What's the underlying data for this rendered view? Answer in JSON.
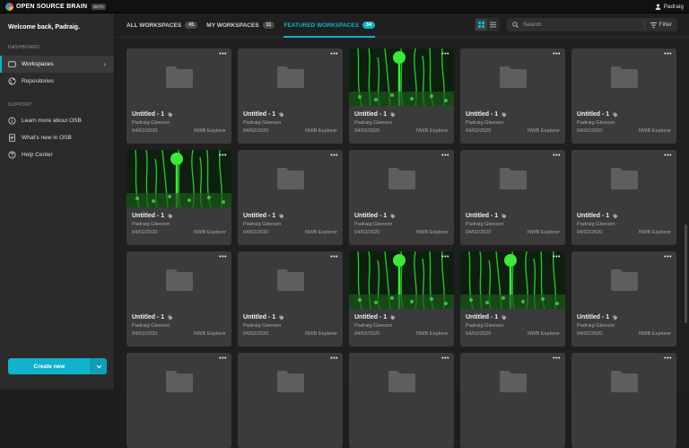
{
  "topbar": {
    "brand": "OPEN SOURCE BRAIN",
    "badge": "BETA",
    "user": "Padraig"
  },
  "sidebar": {
    "welcome": "Welcome back, Padraig.",
    "dashboard_title": "DASHBOARD",
    "items": [
      {
        "label": "Workspaces",
        "icon": "folder-icon",
        "active": true
      },
      {
        "label": "Repositories",
        "icon": "globe-icon"
      }
    ],
    "support_title": "SUPPORT",
    "support_items": [
      {
        "label": "Learn more about OSB",
        "icon": "info-icon"
      },
      {
        "label": "What's new in OSB",
        "icon": "document-icon"
      },
      {
        "label": "Help Center",
        "icon": "help-icon"
      }
    ],
    "create_label": "Create new"
  },
  "tabs": [
    {
      "label": "ALL WORKSPACES",
      "count": "45"
    },
    {
      "label": "MY WORKSPACES",
      "count": "11"
    },
    {
      "label": "FEATURED WORKSPACES",
      "count": "34",
      "active": true
    }
  ],
  "search": {
    "placeholder": "Search"
  },
  "filter_label": "Filter",
  "colors": {
    "accent": "#10b3c9",
    "card": "#3b3b3b",
    "sidebar": "#2b2b2b"
  },
  "cards": [
    {
      "title": "Untitled - 1",
      "owner": "Padraig Gleeson",
      "date": "04/02/2020",
      "app": "NWB Explorer",
      "image": false
    },
    {
      "title": "Untitled - 1",
      "owner": "Padraig Gleeson",
      "date": "04/02/2020",
      "app": "NWB Explorer",
      "image": false
    },
    {
      "title": "Untitled - 1",
      "owner": "Padraig Gleeson",
      "date": "04/02/2020",
      "app": "NWB Explorer",
      "image": true
    },
    {
      "title": "Untitled - 1",
      "owner": "Padraig Gleeson",
      "date": "04/02/2020",
      "app": "NWB Explorer",
      "image": false
    },
    {
      "title": "Untitled - 1",
      "owner": "Padraig Gleeson",
      "date": "04/02/2020",
      "app": "NWB Explorer",
      "image": false
    },
    {
      "title": "Untitled - 1",
      "owner": "Padraig Gleeson",
      "date": "04/02/2020",
      "app": "NWB Explorer",
      "image": true
    },
    {
      "title": "Untitled - 1",
      "owner": "Padraig Gleeson",
      "date": "04/02/2020",
      "app": "NWB Explorer",
      "image": false
    },
    {
      "title": "Untitled - 1",
      "owner": "Padraig Gleeson",
      "date": "04/02/2020",
      "app": "NWB Explorer",
      "image": false
    },
    {
      "title": "Untitled - 1",
      "owner": "Padraig Gleeson",
      "date": "04/02/2020",
      "app": "NWB Explorer",
      "image": false
    },
    {
      "title": "Untitled - 1",
      "owner": "Padraig Gleeson",
      "date": "04/02/2020",
      "app": "NWB Explorer",
      "image": false
    },
    {
      "title": "Untitled - 1",
      "owner": "Padraig Gleeson",
      "date": "04/02/2020",
      "app": "NWB Explorer",
      "image": false
    },
    {
      "title": "Untitled - 1",
      "owner": "Padraig Gleeson",
      "date": "04/02/2020",
      "app": "NWB Explorer",
      "image": false
    },
    {
      "title": "Untitled - 1",
      "owner": "Padraig Gleeson",
      "date": "04/02/2020",
      "app": "NWB Explorer",
      "image": true
    },
    {
      "title": "Untitled - 1",
      "owner": "Padraig Gleeson",
      "date": "04/02/2020",
      "app": "NWB Explorer",
      "image": true
    },
    {
      "title": "Untitled - 1",
      "owner": "Padraig Gleeson",
      "date": "04/02/2020",
      "app": "NWB Explorer",
      "image": false
    },
    {
      "title": "",
      "owner": "",
      "date": "",
      "app": "",
      "image": false
    },
    {
      "title": "",
      "owner": "",
      "date": "",
      "app": "",
      "image": false
    },
    {
      "title": "",
      "owner": "",
      "date": "",
      "app": "",
      "image": false
    },
    {
      "title": "",
      "owner": "",
      "date": "",
      "app": "",
      "image": false
    },
    {
      "title": "",
      "owner": "",
      "date": "",
      "app": "",
      "image": false
    }
  ]
}
